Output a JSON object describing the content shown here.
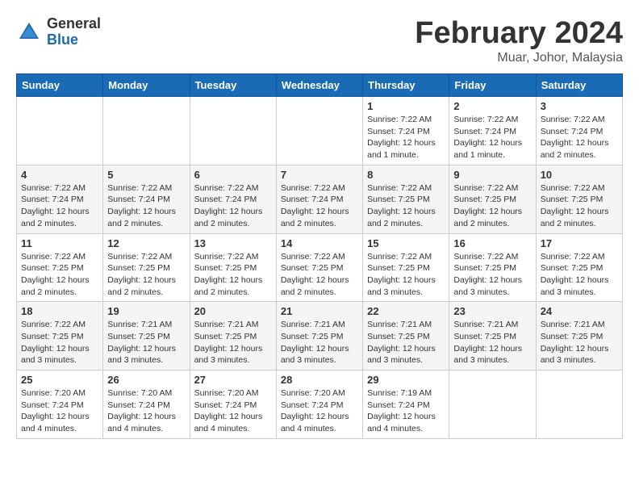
{
  "header": {
    "logo_general": "General",
    "logo_blue": "Blue",
    "month_title": "February 2024",
    "location": "Muar, Johor, Malaysia"
  },
  "days_of_week": [
    "Sunday",
    "Monday",
    "Tuesday",
    "Wednesday",
    "Thursday",
    "Friday",
    "Saturday"
  ],
  "weeks": [
    [
      {
        "day": "",
        "info": ""
      },
      {
        "day": "",
        "info": ""
      },
      {
        "day": "",
        "info": ""
      },
      {
        "day": "",
        "info": ""
      },
      {
        "day": "1",
        "info": "Sunrise: 7:22 AM\nSunset: 7:24 PM\nDaylight: 12 hours and 1 minute."
      },
      {
        "day": "2",
        "info": "Sunrise: 7:22 AM\nSunset: 7:24 PM\nDaylight: 12 hours and 1 minute."
      },
      {
        "day": "3",
        "info": "Sunrise: 7:22 AM\nSunset: 7:24 PM\nDaylight: 12 hours and 2 minutes."
      }
    ],
    [
      {
        "day": "4",
        "info": "Sunrise: 7:22 AM\nSunset: 7:24 PM\nDaylight: 12 hours and 2 minutes."
      },
      {
        "day": "5",
        "info": "Sunrise: 7:22 AM\nSunset: 7:24 PM\nDaylight: 12 hours and 2 minutes."
      },
      {
        "day": "6",
        "info": "Sunrise: 7:22 AM\nSunset: 7:24 PM\nDaylight: 12 hours and 2 minutes."
      },
      {
        "day": "7",
        "info": "Sunrise: 7:22 AM\nSunset: 7:24 PM\nDaylight: 12 hours and 2 minutes."
      },
      {
        "day": "8",
        "info": "Sunrise: 7:22 AM\nSunset: 7:25 PM\nDaylight: 12 hours and 2 minutes."
      },
      {
        "day": "9",
        "info": "Sunrise: 7:22 AM\nSunset: 7:25 PM\nDaylight: 12 hours and 2 minutes."
      },
      {
        "day": "10",
        "info": "Sunrise: 7:22 AM\nSunset: 7:25 PM\nDaylight: 12 hours and 2 minutes."
      }
    ],
    [
      {
        "day": "11",
        "info": "Sunrise: 7:22 AM\nSunset: 7:25 PM\nDaylight: 12 hours and 2 minutes."
      },
      {
        "day": "12",
        "info": "Sunrise: 7:22 AM\nSunset: 7:25 PM\nDaylight: 12 hours and 2 minutes."
      },
      {
        "day": "13",
        "info": "Sunrise: 7:22 AM\nSunset: 7:25 PM\nDaylight: 12 hours and 2 minutes."
      },
      {
        "day": "14",
        "info": "Sunrise: 7:22 AM\nSunset: 7:25 PM\nDaylight: 12 hours and 2 minutes."
      },
      {
        "day": "15",
        "info": "Sunrise: 7:22 AM\nSunset: 7:25 PM\nDaylight: 12 hours and 3 minutes."
      },
      {
        "day": "16",
        "info": "Sunrise: 7:22 AM\nSunset: 7:25 PM\nDaylight: 12 hours and 3 minutes."
      },
      {
        "day": "17",
        "info": "Sunrise: 7:22 AM\nSunset: 7:25 PM\nDaylight: 12 hours and 3 minutes."
      }
    ],
    [
      {
        "day": "18",
        "info": "Sunrise: 7:22 AM\nSunset: 7:25 PM\nDaylight: 12 hours and 3 minutes."
      },
      {
        "day": "19",
        "info": "Sunrise: 7:21 AM\nSunset: 7:25 PM\nDaylight: 12 hours and 3 minutes."
      },
      {
        "day": "20",
        "info": "Sunrise: 7:21 AM\nSunset: 7:25 PM\nDaylight: 12 hours and 3 minutes."
      },
      {
        "day": "21",
        "info": "Sunrise: 7:21 AM\nSunset: 7:25 PM\nDaylight: 12 hours and 3 minutes."
      },
      {
        "day": "22",
        "info": "Sunrise: 7:21 AM\nSunset: 7:25 PM\nDaylight: 12 hours and 3 minutes."
      },
      {
        "day": "23",
        "info": "Sunrise: 7:21 AM\nSunset: 7:25 PM\nDaylight: 12 hours and 3 minutes."
      },
      {
        "day": "24",
        "info": "Sunrise: 7:21 AM\nSunset: 7:25 PM\nDaylight: 12 hours and 3 minutes."
      }
    ],
    [
      {
        "day": "25",
        "info": "Sunrise: 7:20 AM\nSunset: 7:24 PM\nDaylight: 12 hours and 4 minutes."
      },
      {
        "day": "26",
        "info": "Sunrise: 7:20 AM\nSunset: 7:24 PM\nDaylight: 12 hours and 4 minutes."
      },
      {
        "day": "27",
        "info": "Sunrise: 7:20 AM\nSunset: 7:24 PM\nDaylight: 12 hours and 4 minutes."
      },
      {
        "day": "28",
        "info": "Sunrise: 7:20 AM\nSunset: 7:24 PM\nDaylight: 12 hours and 4 minutes."
      },
      {
        "day": "29",
        "info": "Sunrise: 7:19 AM\nSunset: 7:24 PM\nDaylight: 12 hours and 4 minutes."
      },
      {
        "day": "",
        "info": ""
      },
      {
        "day": "",
        "info": ""
      }
    ]
  ]
}
